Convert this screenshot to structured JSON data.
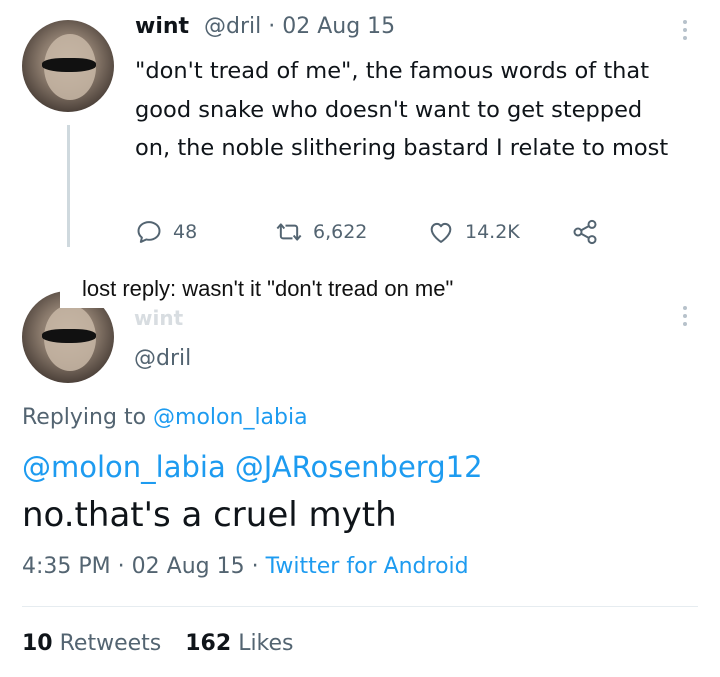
{
  "tweet": {
    "display_name": "wint",
    "handle": "@dril",
    "separator": "·",
    "date": "02 Aug 15",
    "text": "\"don't tread of me\", the famous words of that good snake who doesn't want to get stepped on, the noble slithering bastard I relate to most",
    "actions": {
      "replies": "48",
      "retweets": "6,622",
      "likes": "14.2K"
    },
    "icons": [
      "reply-icon",
      "retweet-icon",
      "like-icon",
      "share-icon",
      "more-icon"
    ]
  },
  "lost_reply": {
    "text": "lost reply: wasn't it \"don't tread on me\""
  },
  "reply": {
    "display_name": "wint",
    "handle": "@dril",
    "replying_prefix": "Replying to",
    "replying_to": "@molon_labia",
    "mentions": [
      "@molon_labia",
      "@JARosenberg12"
    ],
    "text": "no.that's a cruel myth",
    "time": "4:35 PM",
    "separator": "·",
    "date": "02 Aug 15",
    "source": "Twitter for Android",
    "retweets_count": "10",
    "retweets_label": "Retweets",
    "likes_count": "162",
    "likes_label": "Likes"
  },
  "colors": {
    "link": "#1d9bf0",
    "secondary_text": "#536471",
    "primary_text": "#0f1419"
  }
}
